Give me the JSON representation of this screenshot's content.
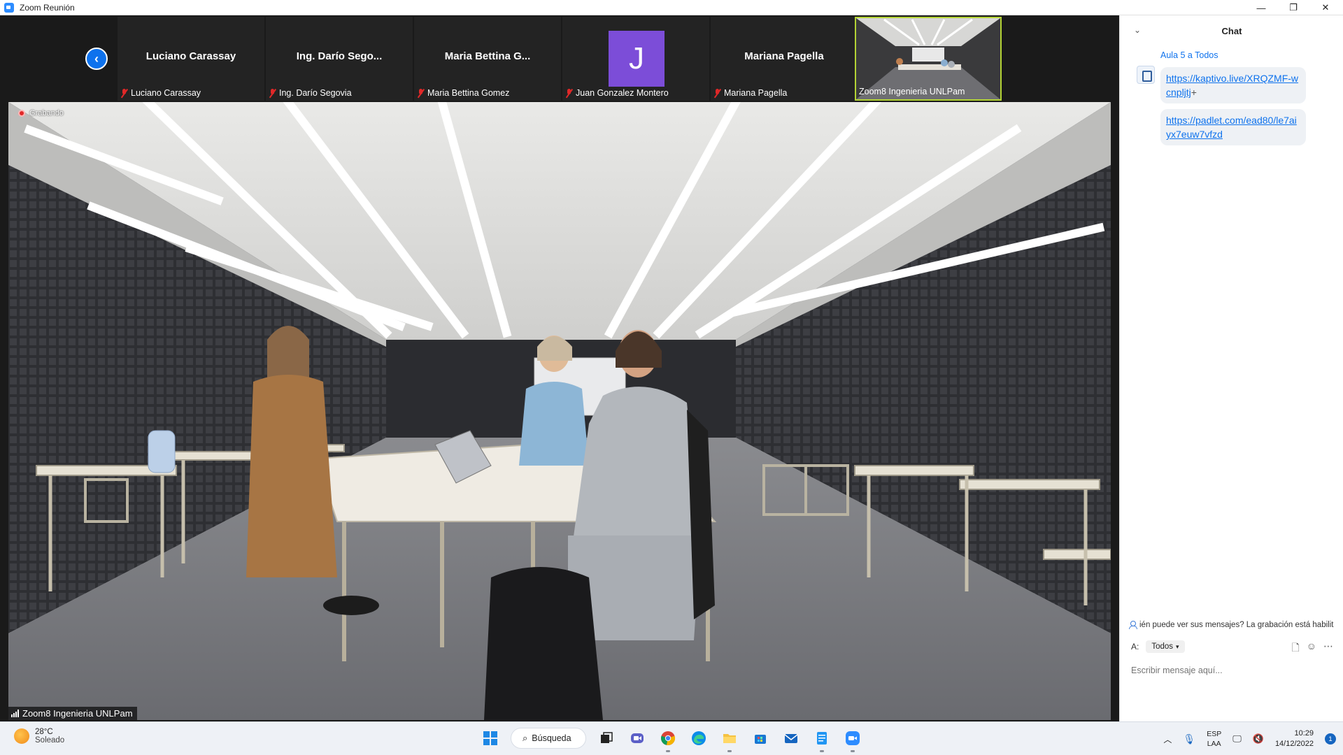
{
  "window": {
    "title": "Zoom Reunión",
    "controls": {
      "minimize": "—",
      "restore": "❐",
      "close": "✕"
    }
  },
  "participants_strip": [
    {
      "display_name": "Luciano Carassay",
      "label": "Luciano Carassay",
      "muted": true
    },
    {
      "display_name": "Ing. Darío Sego...",
      "label": "Ing. Darío Segovia",
      "muted": true
    },
    {
      "display_name": "Maria Bettina G...",
      "label": "Maria Bettina Gomez",
      "muted": true
    },
    {
      "display_name": "J",
      "label": "Juan Gonzalez Montero",
      "muted": true,
      "avatar_color": "#7c4dd8"
    },
    {
      "display_name": "Mariana Pagella",
      "label": "Mariana Pagella",
      "muted": true
    },
    {
      "display_name": "",
      "label": "Zoom8 Ingenieria UNLPam",
      "muted": false,
      "active_speaker": true
    }
  ],
  "main_video": {
    "recording_label": "Grabando",
    "speaker_label": "Zoom8 Ingenieria UNLPam"
  },
  "chat": {
    "title": "Chat",
    "sender_line": "Aula 5 a Todos",
    "messages": [
      {
        "link": "https://kaptivo.live/XRQZMF-wcnpljtj",
        "suffix": "+"
      },
      {
        "link": "https://padlet.com/ead80/le7aiyx7euw7vfzd",
        "suffix": ""
      }
    ],
    "notice": "ién puede ver sus mensajes? La grabación está habilit",
    "to_label": "A:",
    "to_value": "Todos",
    "input_placeholder": "Escribir mensaje aquí..."
  },
  "taskbar": {
    "weather_temp": "28°C",
    "weather_desc": "Soleado",
    "search_label": "Búsqueda",
    "lang_line1": "ESP",
    "lang_line2": "LAA",
    "time": "10:29",
    "date": "14/12/2022",
    "notification_count": "1"
  },
  "colors": {
    "zoom_blue": "#0e72ed",
    "muted_red": "#e02828",
    "active_border": "#b3d334"
  }
}
